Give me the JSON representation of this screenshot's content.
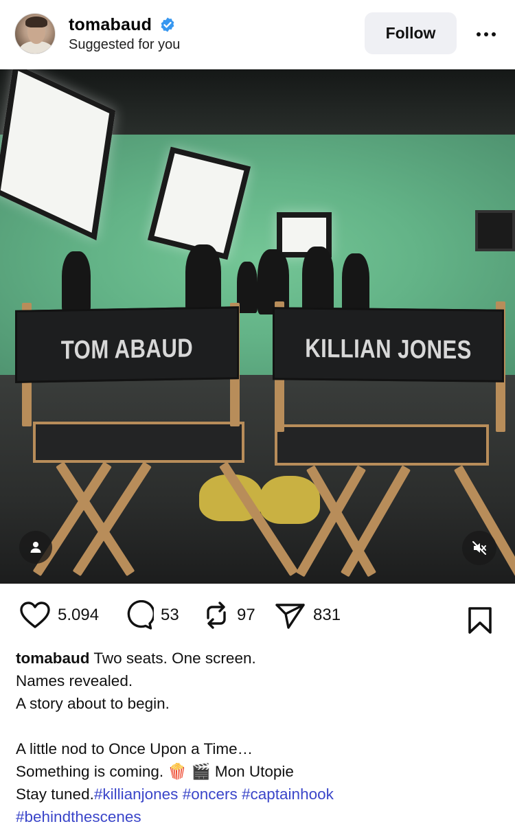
{
  "post_header": {
    "username": "tomabaud",
    "subtitle": "Suggested for you",
    "follow_label": "Follow",
    "verified_icon": "verified-badge-icon",
    "verified_color": "#3797f0"
  },
  "photo": {
    "left_chair_name": "TOM ABAUD",
    "right_chair_name": "KILLIAN JONES"
  },
  "actions": {
    "likes": "5.094",
    "comments": "53",
    "reposts": "97",
    "shares": "831"
  },
  "caption": {
    "username": "tomabaud",
    "first_line": " Two seats. One screen.",
    "lines": [
      "Names revealed.",
      "A story about to begin.",
      "",
      "A little nod to Once Upon a Time…",
      "Something is coming. 🍿 🎬 Mon Utopie"
    ],
    "last_line_prefix": "Stay tuned.",
    "hashtags_line1": [
      "#killianjones",
      "#oncers",
      "#captainhook"
    ],
    "hashtags_line2": [
      "#behindthescenes"
    ],
    "hashtag_color": "#3a45c9"
  }
}
